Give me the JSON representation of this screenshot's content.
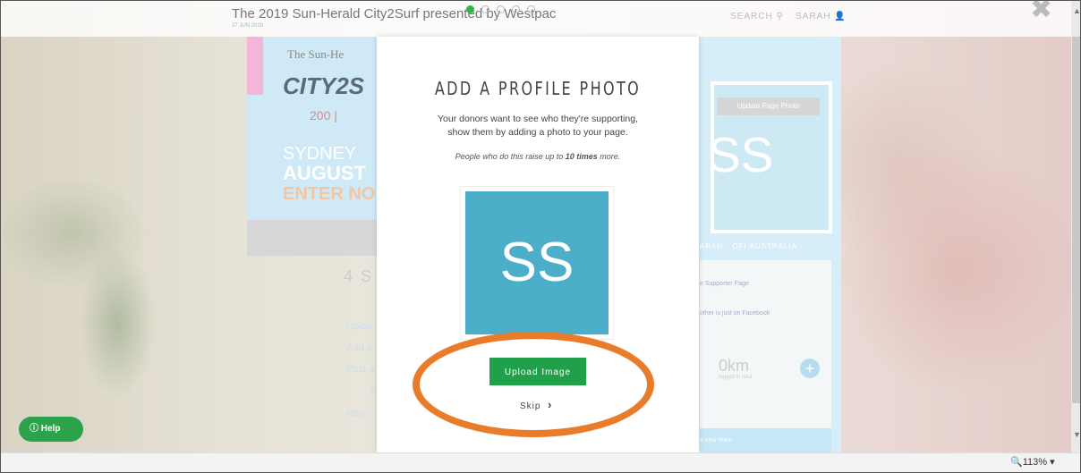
{
  "header": {
    "site_title": "The 2019 Sun-Herald City2Surf presented by Westpac",
    "date": "27 JUN 2019",
    "search_label": "SEARCH",
    "user_label": "SARAH",
    "close_glyph": "✖"
  },
  "banner": {
    "logo_top": "The Sun-He",
    "logo_city": "CITY2S",
    "logo_200": "200 |",
    "line1": "SYDNEY",
    "line2": "AUGUST",
    "line3": "ENTER NO"
  },
  "page": {
    "steps_heading": "4 S",
    "links": [
      "Uploa",
      "Add a",
      "Post a",
      "Sl",
      "https:/"
    ]
  },
  "right_panel": {
    "update_photo": "Update Page Photo",
    "initials": "SS",
    "name": "ARAH - OFI AUSTRALIA",
    "items": [
      "e Supporter Page",
      "other is just on Facebook"
    ],
    "km_value": "0km",
    "km_sub": "logged in total",
    "plus": "+",
    "team": "a new team"
  },
  "help_label": "Help",
  "modal": {
    "title": "ADD A PROFILE PHOTO",
    "desc_line1": "Your donors want to see who they're supporting,",
    "desc_line2": "show them by adding a photo to your page.",
    "note_prefix": "People who do this raise up to ",
    "note_bold": "10 times",
    "note_suffix": " more.",
    "avatar_initials": "SS",
    "upload_label": "Upload Image",
    "skip_label": "Skip",
    "skip_arrow": "›"
  },
  "statusbar": {
    "zoom": "113%"
  },
  "colors": {
    "accent_green": "#1fa049",
    "avatar_blue": "#4daec9",
    "annotation_orange": "#e87c2a"
  }
}
